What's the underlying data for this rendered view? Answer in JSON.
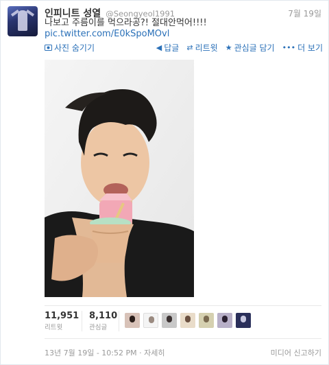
{
  "tweet": {
    "fullname": "인피니트 성열",
    "screenname": "@Seongyeol1991",
    "time": "7월 19일",
    "text": "나보고 주름이를 먹으라공?! 절대안먹어!!!!",
    "link": "pic.twitter.com/E0kSpoMOvl"
  },
  "actions": {
    "hide_photo": "사진 숨기기",
    "reply": "답글",
    "retweet": "리트윗",
    "favorite": "관심글 담기",
    "more": "더 보기"
  },
  "stats": {
    "retweets": {
      "count": "11,951",
      "label": "리트윗"
    },
    "favorites": {
      "count": "8,110",
      "label": "관심글"
    }
  },
  "footer": {
    "timestamp": "13년 7월 19일 - 10:52 PM",
    "details": "자세히",
    "flag_media": "미디어 신고하기"
  },
  "colors": {
    "link": "#2a70b8",
    "muted": "#999999",
    "text": "#333333"
  },
  "icons": {
    "photo": "photo-icon",
    "reply": "reply-arrow-icon",
    "retweet": "retweet-icon",
    "favorite": "star-icon",
    "more": "more-dots-icon"
  }
}
